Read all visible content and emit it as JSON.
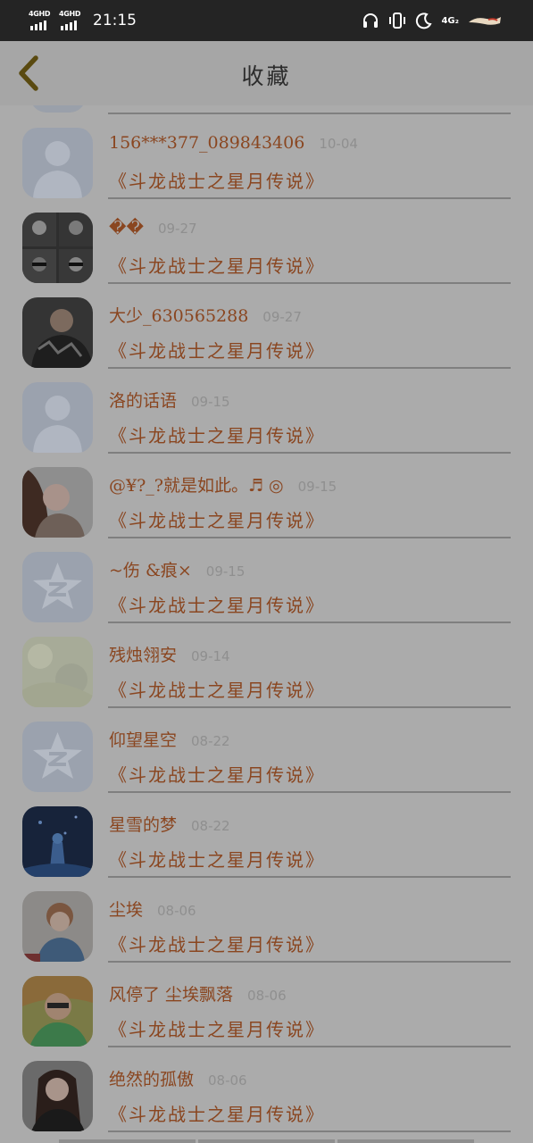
{
  "status_bar": {
    "signal_1_tag": "4GHD",
    "signal_2_tag": "4GHD",
    "time": "21:15",
    "network": "4G₂",
    "icons": [
      "headphones-icon",
      "vibrate-icon",
      "moon-icon"
    ]
  },
  "header": {
    "title": "收藏",
    "back_icon": "chevron-left-icon"
  },
  "favorites": [
    {
      "name": "156***377_089843406",
      "date": "10-04",
      "title": "《斗龙战士之星月传说》",
      "avatar": "default-person"
    },
    {
      "name": "��",
      "date": "09-27",
      "title": "《斗龙战士之星月传说》",
      "avatar": "photo-group"
    },
    {
      "name": "大少_630565288",
      "date": "09-27",
      "title": "《斗龙战士之星月传说》",
      "avatar": "photo"
    },
    {
      "name": "洛的话语",
      "date": "09-15",
      "title": "《斗龙战士之星月传说》",
      "avatar": "default-person"
    },
    {
      "name": "@¥?_?就是如此。♬ ◎",
      "date": "09-15",
      "title": "《斗龙战士之星月传说》",
      "avatar": "photo"
    },
    {
      "name": "~伤 &痕×",
      "date": "09-15",
      "title": "《斗龙战士之星月传说》",
      "avatar": "qzone-star"
    },
    {
      "name": "残烛翎安",
      "date": "09-14",
      "title": "《斗龙战士之星月传说》",
      "avatar": "photo-light"
    },
    {
      "name": "仰望星空",
      "date": "08-22",
      "title": "《斗龙战士之星月传说》",
      "avatar": "qzone-star"
    },
    {
      "name": "星雪的梦",
      "date": "08-22",
      "title": "《斗龙战士之星月传说》",
      "avatar": "photo-night"
    },
    {
      "name": "尘埃",
      "date": "08-06",
      "title": "《斗龙战士之星月传说》",
      "avatar": "photo"
    },
    {
      "name": "风停了 尘埃飘落",
      "date": "08-06",
      "title": "《斗龙战士之星月传说》",
      "avatar": "photo-colorful"
    },
    {
      "name": "绝然的孤傲",
      "date": "08-06",
      "title": "《斗龙战士之星月传说》",
      "avatar": "photo"
    }
  ],
  "colors": {
    "status_bar_bg": "#242424",
    "page_bg": "#ababab",
    "accent_text": "#8a4620",
    "date_text": "#8f8f8f",
    "back_icon": "#5a4a10",
    "divider": "#7f7f7f"
  }
}
